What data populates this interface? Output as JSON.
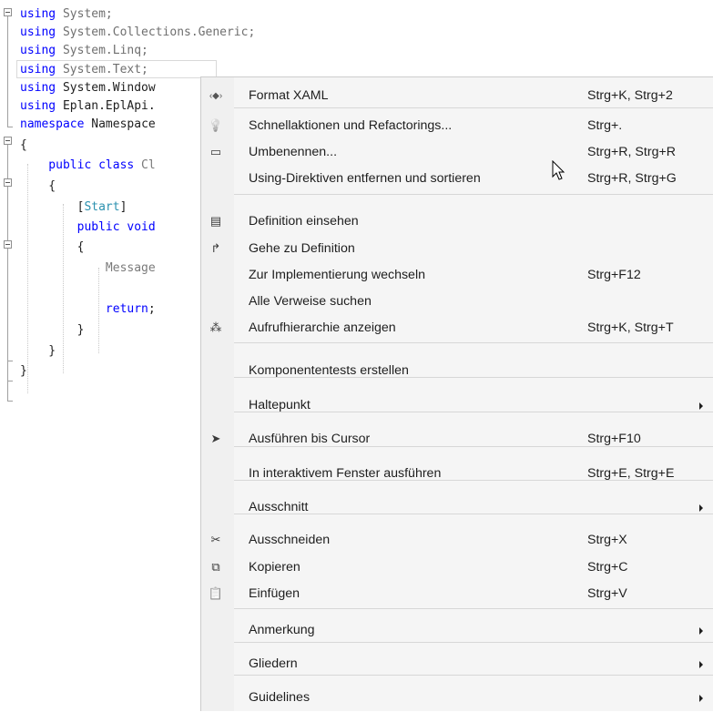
{
  "editor": {
    "lines": [
      {
        "parts": [
          {
            "t": "using",
            "c": "kw"
          },
          {
            "t": " System;",
            "c": ""
          }
        ],
        "dim": true
      },
      {
        "parts": [
          {
            "t": "using",
            "c": "kw"
          },
          {
            "t": " System.Collections.Generic;",
            "c": ""
          }
        ],
        "dim": true
      },
      {
        "parts": [
          {
            "t": "using",
            "c": "kw"
          },
          {
            "t": " System.Linq;",
            "c": ""
          }
        ],
        "dim": true
      },
      {
        "parts": [
          {
            "t": "using",
            "c": "kw"
          },
          {
            "t": " System.Text;",
            "c": ""
          }
        ],
        "dim": true
      },
      {
        "parts": [
          {
            "t": "using",
            "c": "kw"
          },
          {
            "t": " System.Window",
            "c": ""
          }
        ],
        "dim": false
      },
      {
        "parts": [
          {
            "t": "using",
            "c": "kw"
          },
          {
            "t": " Eplan.EplApi.",
            "c": ""
          }
        ],
        "dim": false
      },
      {
        "parts": [
          {
            "t": "namespace",
            "c": "kw"
          },
          {
            "t": " Namespace",
            "c": ""
          }
        ],
        "dim": false
      },
      {
        "parts": [
          {
            "t": "{",
            "c": ""
          }
        ],
        "dim": false
      },
      {
        "parts": [
          {
            "t": "    public class",
            "c": "kw"
          },
          {
            "t": " Cl",
            "c": "dimtxt"
          }
        ],
        "dim": false
      },
      {
        "parts": [
          {
            "t": "    {",
            "c": ""
          }
        ],
        "dim": false
      },
      {
        "parts": [
          {
            "t": "        [",
            "c": ""
          },
          {
            "t": "Start",
            "c": "attr"
          },
          {
            "t": "]",
            "c": ""
          }
        ],
        "dim": false
      },
      {
        "parts": [
          {
            "t": "        public void",
            "c": "kw"
          }
        ],
        "dim": false
      },
      {
        "parts": [
          {
            "t": "        {",
            "c": ""
          }
        ],
        "dim": false
      },
      {
        "parts": [
          {
            "t": "            Message",
            "c": "dimtxt"
          }
        ],
        "dim": false
      },
      {
        "parts": [
          {
            "t": "",
            "c": ""
          }
        ],
        "dim": false
      },
      {
        "parts": [
          {
            "t": "            return",
            "c": "kw"
          },
          {
            "t": ";",
            "c": ""
          }
        ],
        "dim": false
      },
      {
        "parts": [
          {
            "t": "        }",
            "c": ""
          }
        ],
        "dim": false
      },
      {
        "parts": [
          {
            "t": "    }",
            "c": ""
          }
        ],
        "dim": false
      },
      {
        "parts": [
          {
            "t": "}",
            "c": ""
          }
        ],
        "dim": false
      }
    ]
  },
  "context_menu": {
    "items": [
      {
        "label": "Format XAML",
        "shortcut": "Strg+K, Strg+2",
        "icon": "xaml-format-icon",
        "glyph": "‹◆›",
        "submenu": false
      },
      {
        "label": "Schnellaktionen und Refactorings...",
        "shortcut": "Strg+.",
        "icon": "lightbulb-icon",
        "glyph": "💡",
        "submenu": false
      },
      {
        "label": "Umbenennen...",
        "shortcut": "Strg+R, Strg+R",
        "icon": "rename-icon",
        "glyph": "▭",
        "submenu": false
      },
      {
        "label": "Using-Direktiven entfernen und sortieren",
        "shortcut": "Strg+R, Strg+G",
        "icon": "",
        "glyph": "",
        "submenu": false
      },
      {
        "label": "Definition einsehen",
        "shortcut": "",
        "icon": "peek-definition-icon",
        "glyph": "▤",
        "submenu": false
      },
      {
        "label": "Gehe zu Definition",
        "shortcut": "",
        "icon": "go-to-definition-icon",
        "glyph": "↱",
        "submenu": false
      },
      {
        "label": "Zur Implementierung wechseln",
        "shortcut": "Strg+F12",
        "icon": "",
        "glyph": "",
        "submenu": false
      },
      {
        "label": "Alle Verweise suchen",
        "shortcut": "",
        "icon": "",
        "glyph": "",
        "submenu": false
      },
      {
        "label": "Aufrufhierarchie anzeigen",
        "shortcut": "Strg+K, Strg+T",
        "icon": "call-hierarchy-icon",
        "glyph": "⁂",
        "submenu": false
      },
      {
        "label": "Komponententests erstellen",
        "shortcut": "",
        "icon": "",
        "glyph": "",
        "submenu": false
      },
      {
        "label": "Haltepunkt",
        "shortcut": "",
        "icon": "",
        "glyph": "",
        "submenu": true
      },
      {
        "label": "Ausführen bis Cursor",
        "shortcut": "Strg+F10",
        "icon": "run-to-cursor-icon",
        "glyph": "➤",
        "submenu": false
      },
      {
        "label": "In interaktivem Fenster ausführen",
        "shortcut": "Strg+E, Strg+E",
        "icon": "",
        "glyph": "",
        "submenu": false
      },
      {
        "label": "Ausschnitt",
        "shortcut": "",
        "icon": "",
        "glyph": "",
        "submenu": true
      },
      {
        "label": "Ausschneiden",
        "shortcut": "Strg+X",
        "icon": "cut-icon",
        "glyph": "✂",
        "submenu": false
      },
      {
        "label": "Kopieren",
        "shortcut": "Strg+C",
        "icon": "copy-icon",
        "glyph": "⧉",
        "submenu": false
      },
      {
        "label": "Einfügen",
        "shortcut": "Strg+V",
        "icon": "paste-icon",
        "glyph": "📋",
        "submenu": false
      },
      {
        "label": "Anmerkung",
        "shortcut": "",
        "icon": "",
        "glyph": "",
        "submenu": true
      },
      {
        "label": "Gliedern",
        "shortcut": "",
        "icon": "",
        "glyph": "",
        "submenu": true
      },
      {
        "label": "Guidelines",
        "shortcut": "",
        "icon": "",
        "glyph": "",
        "submenu": true
      }
    ]
  },
  "colors": {
    "keyword": "#0000ff",
    "attribute": "#2b91af",
    "menu_background": "#f5f5f5",
    "menu_gutter": "#f0f0f0"
  }
}
